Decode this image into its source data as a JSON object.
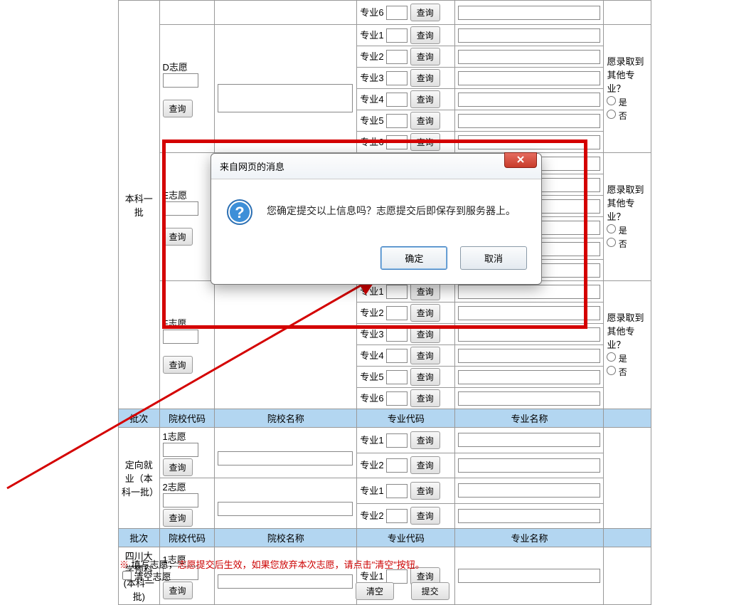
{
  "labels": {
    "batch": "批次",
    "schoolCode": "院校代码",
    "schoolName": "院校名称",
    "majorCode": "专业代码",
    "majorName": "专业名称",
    "query": "查询",
    "major": "专业",
    "wish": "志愿",
    "yes": "是",
    "no": "否",
    "otherAccept": "愿录取到其他专业？",
    "clear": "清空",
    "submit": "提交",
    "clearWish": "清空志愿",
    "asterisk": "※"
  },
  "batches": {
    "benke1": "本科一批",
    "dingxiang": "定向就业（本科一批）",
    "sichuan": "四川大学预科(本科一批)"
  },
  "wishes": {
    "D": "D志愿",
    "E": "E志愿",
    "F": "F志愿",
    "n1": "1志愿",
    "n2": "2志愿"
  },
  "majorNums": [
    "1",
    "2",
    "3",
    "4",
    "5",
    "6"
  ],
  "dialog": {
    "title": "来自网页的消息",
    "message": "您确定提交以上信息吗？志愿提交后即保存到服务器上。",
    "ok": "确定",
    "cancel": "取消",
    "closeX": "X"
  },
  "footer": {
    "prefix": " 填写志愿，",
    "red": "志愿提交后生效，如果您放弃本次志愿，请点击\"清空\"按钮。"
  }
}
